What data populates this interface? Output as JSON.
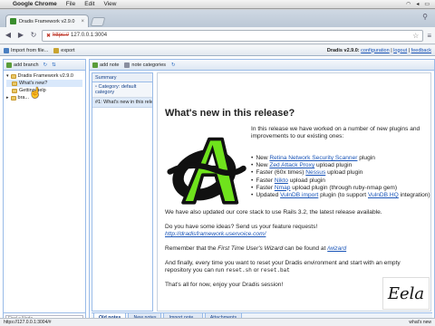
{
  "os_menubar": {
    "app": "Google Chrome",
    "items": [
      "File",
      "Edit",
      "View"
    ]
  },
  "browser": {
    "tab_title": "Dradis Framework v2.9.0",
    "url_scheme": "https://",
    "url_host": "127.0.0.1:3004"
  },
  "app_toolbar": {
    "import_label": "Import from file...",
    "export_label": "export",
    "version_text": "Dradis v2.9.0:",
    "links": [
      "configuration",
      "logout",
      "feedback"
    ]
  },
  "left_panel": {
    "add_branch": "add branch",
    "tree": [
      {
        "label": "Dradis Framework v2.9.0",
        "level": 0
      },
      {
        "label": "What's new?",
        "level": 1,
        "selected": true
      },
      {
        "label": "Getting help",
        "level": 1
      },
      {
        "label": "bra...",
        "level": 0
      }
    ],
    "filter_placeholder": "Find a Node"
  },
  "center_toolbar": {
    "add_note": "add note",
    "note_categories": "note categories"
  },
  "summary": {
    "header": "Summary",
    "category": "Category: default category",
    "row": "#1: What's new in this relea"
  },
  "note": {
    "title": "What's new in this release?",
    "intro": "In this release we have worked on a number of new plugins and improvements to our existing ones:",
    "bullets": [
      {
        "pre": "New ",
        "link": "Retina Network Security Scanner",
        "post": " plugin"
      },
      {
        "pre": "New ",
        "link": "Zed Attack Proxy",
        "post": " upload plugin"
      },
      {
        "pre": "Faster (60x times) ",
        "link": "Nessus",
        "post": " upload plugin"
      },
      {
        "pre": "Faster ",
        "link": "Nikto",
        "post": " upload plugin"
      },
      {
        "pre": "Faster ",
        "link": "Nmap",
        "post": " upload plugin (through ruby-nmap gem)"
      },
      {
        "pre": "Updated ",
        "link": "VulnDB import",
        "post": " plugin (to support ",
        "link2": "VulnDB HQ",
        "post2": " integration)"
      }
    ],
    "p_core": "We have also updated our core stack to use Rails 3.2, the latest release available.",
    "p_ideas": "Do you have some ideas? Send us your feature requests!",
    "p_ideas_link": "http://dradisframework.uservoice.com/",
    "p_wizard_pre": "Remember that the ",
    "p_wizard_em": "First Time User's Wizard",
    "p_wizard_mid": " can be found at ",
    "p_wizard_link": "/wizard",
    "p_reset_pre": "And finally, every time you want to reset your Dradis environment and start with an empty repository you can run ",
    "p_reset_cmd1": "reset.sh",
    "p_reset_or": " or ",
    "p_reset_cmd2": "reset.bat",
    "p_end": "That's all for now, enjoy your Dradis session!"
  },
  "bottom_tabs": [
    "Old notes",
    "New notes",
    "Import note...",
    "Attachments"
  ],
  "status": {
    "left": "https://127.0.0.1:3004/#",
    "right": "what's new"
  },
  "watermark": "Eela",
  "colors": {
    "logo_green": "#6fe21c",
    "logo_dark": "#111111",
    "link": "#1a55b8"
  }
}
